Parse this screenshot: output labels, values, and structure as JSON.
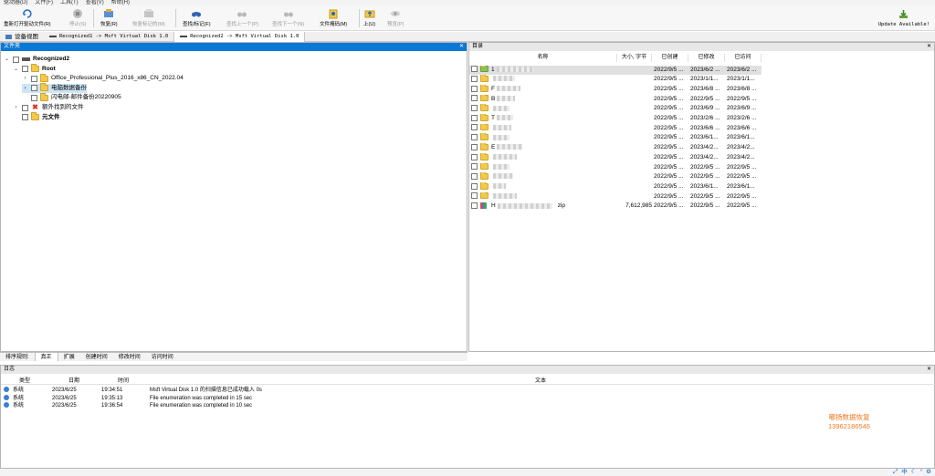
{
  "menu": [
    "驱动器(D)",
    "文件(F)",
    "工具(T)",
    "查看(V)",
    "帮助(H)"
  ],
  "toolbar": {
    "items": [
      {
        "label": "重新打开驱动文件(R)",
        "icon": "reopen-icon",
        "enabled": true
      },
      {
        "label": "停止(S)",
        "icon": "stop-icon",
        "enabled": false
      },
      {
        "label": "恢复(R)",
        "icon": "recover-icon",
        "enabled": true
      },
      {
        "label": "恢复标记的(M)",
        "icon": "recover-marked-icon",
        "enabled": false
      },
      {
        "label": "查找/标记(F)",
        "icon": "binoculars-icon",
        "enabled": true
      },
      {
        "label": "查找上一个(P)",
        "icon": "find-prev-icon",
        "enabled": false
      },
      {
        "label": "查找下一个(N)",
        "icon": "find-next-icon",
        "enabled": false
      },
      {
        "label": "文件掩码(M)",
        "icon": "file-mask-icon",
        "enabled": true
      },
      {
        "label": "上(U)",
        "icon": "folder-up-icon",
        "enabled": true
      },
      {
        "label": "预览(P)",
        "icon": "preview-icon",
        "enabled": false
      }
    ],
    "update": "Update Available!"
  },
  "tabs": [
    {
      "label": "设备视图"
    },
    {
      "label": "Recognized1 -> Msft Virtual Disk 1.0"
    },
    {
      "label": "Recognized2 -> Msft Virtual Disk 1.0"
    }
  ],
  "left_panel": {
    "title": "文件夹",
    "tree": [
      {
        "label": "Recognized2",
        "level": 0,
        "expand": "down",
        "kind": "drive",
        "bold": true
      },
      {
        "label": "Root",
        "level": 1,
        "expand": "down",
        "kind": "folder",
        "bold": true
      },
      {
        "label": "Office_Professional_Plus_2016_x86_CN_2022.04",
        "level": 2,
        "expand": "right",
        "kind": "folder",
        "bold": false
      },
      {
        "label": "电脑数据备份",
        "level": 2,
        "expand": "right",
        "kind": "folder",
        "bold": false,
        "selected": true
      },
      {
        "label": "闪电邮-邮件备份20220905",
        "level": 2,
        "expand": "",
        "kind": "folder",
        "bold": false
      },
      {
        "label": "额外找到的文件",
        "level": 1,
        "expand": "right",
        "kind": "extra",
        "bold": false
      },
      {
        "label": "元文件",
        "level": 1,
        "expand": "",
        "kind": "folder",
        "bold": true
      }
    ]
  },
  "right_panel": {
    "title": "目录",
    "columns": [
      "名称",
      "大小, 字节",
      "已创建",
      "已修改",
      "已访问"
    ],
    "rows": [
      {
        "name": "1",
        "size": "",
        "created": "2022/9/5 ...",
        "modified": "2023/6/2 ...",
        "accessed": "2023/6/2 ..."
      },
      {
        "name": "",
        "size": "",
        "created": "2022/9/5 ...",
        "modified": "2023/1/1...",
        "accessed": "2023/1/1..."
      },
      {
        "name": "F",
        "size": "",
        "created": "2022/9/5 ...",
        "modified": "2023/6/8 ...",
        "accessed": "2023/6/8 ..."
      },
      {
        "name": "B",
        "size": "",
        "created": "2022/9/5 ...",
        "modified": "2022/9/5 ...",
        "accessed": "2022/9/5 ..."
      },
      {
        "name": "",
        "size": "",
        "created": "2022/9/5 ...",
        "modified": "2023/6/9 ...",
        "accessed": "2023/6/9 ..."
      },
      {
        "name": "T",
        "size": "",
        "created": "2022/9/5 ...",
        "modified": "2023/2/6 ...",
        "accessed": "2023/2/6 ..."
      },
      {
        "name": "",
        "size": "",
        "created": "2022/9/5 ...",
        "modified": "2023/6/6 ...",
        "accessed": "2023/6/6 ..."
      },
      {
        "name": "",
        "size": "",
        "created": "2022/9/5 ...",
        "modified": "2023/6/1...",
        "accessed": "2023/6/1..."
      },
      {
        "name": "E",
        "size": "",
        "created": "2022/9/5 ...",
        "modified": "2023/4/2...",
        "accessed": "2023/4/2..."
      },
      {
        "name": "",
        "size": "",
        "created": "2022/9/5 ...",
        "modified": "2023/4/2...",
        "accessed": "2023/4/2..."
      },
      {
        "name": "",
        "size": "",
        "created": "2022/9/5 ...",
        "modified": "2022/9/5 ...",
        "accessed": "2022/9/5 ..."
      },
      {
        "name": "",
        "size": "",
        "created": "2022/9/5 ...",
        "modified": "2022/9/5 ...",
        "accessed": "2022/9/5 ..."
      },
      {
        "name": "",
        "size": "",
        "created": "2022/9/5 ...",
        "modified": "2023/6/1...",
        "accessed": "2023/6/1..."
      },
      {
        "name": "",
        "size": "",
        "created": "2022/9/5 ...",
        "modified": "2022/9/5 ...",
        "accessed": "2022/9/5 ..."
      },
      {
        "name": "H",
        "size": "7,612,985",
        "created": "2022/9/5 ...",
        "modified": "2022/9/5 ...",
        "accessed": "2022/9/5 ...",
        "suffix": "zip",
        "file": true
      }
    ]
  },
  "sort_bar": {
    "label": "排序规则:",
    "items": [
      "真正",
      "扩展",
      "创建时间",
      "修改时间",
      "访问时间"
    ]
  },
  "log": {
    "title": "日志",
    "columns": [
      "类型",
      "日期",
      "时间",
      "文本"
    ],
    "rows": [
      {
        "type": "系统",
        "date": "2023/6/25",
        "time": "19:34:51",
        "text": "Msft Virtual Disk 1.0 的扫描信息已成功载入 0s"
      },
      {
        "type": "系统",
        "date": "2023/6/25",
        "time": "19:35:13",
        "text": "File enumeration was completed in 15 sec"
      },
      {
        "type": "系统",
        "date": "2023/6/25",
        "time": "19:36:54",
        "text": "File enumeration was completed in 10 sec"
      }
    ]
  },
  "watermark": {
    "line1": "嘟扬数据恢复",
    "line2": "13962186546"
  },
  "tray": [
    "中"
  ]
}
